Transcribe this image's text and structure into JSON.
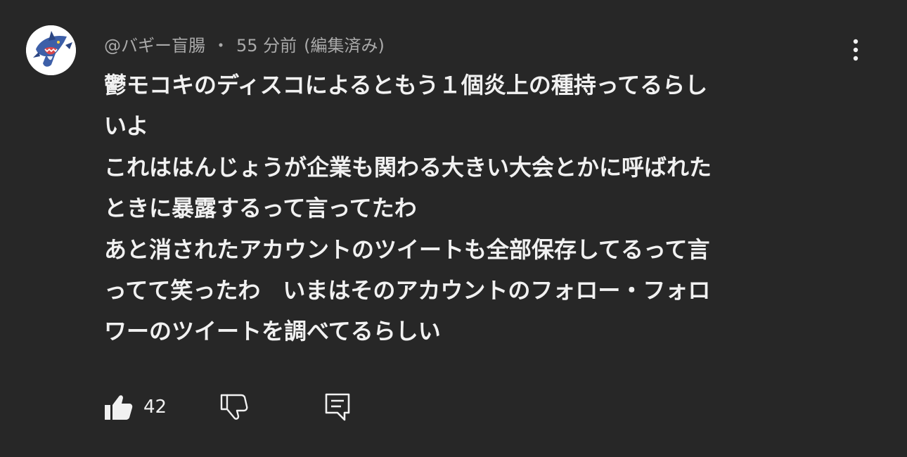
{
  "comment": {
    "author": "@バギー盲腸",
    "separator": "・",
    "time": "55 分前",
    "edited": "(編集済み)",
    "avatar_icon": "shark-avatar",
    "lines": [
      "鬱モコキのディスコによるともう１個炎上の種持ってるらし",
      "いよ",
      "これははんじょうが企業も関わる大きい大会とかに呼ばれた",
      "ときに暴露するって言ってたわ",
      "あと消されたアカウントのツイートも全部保存してるって言",
      "ってて笑ったわ　いまはそのアカウントのフォロー・フォロ",
      "ワーのツイートを調べてるらしい"
    ],
    "actions": {
      "like_icon": "thumbs-up-filled-icon",
      "like_count": "42",
      "dislike_icon": "thumbs-down-outline-icon",
      "reply_icon": "reply-comment-icon"
    },
    "menu_icon": "more-vertical-icon"
  },
  "colors": {
    "background": "#272727",
    "text_primary": "#f1f1f1",
    "text_secondary": "#aaaaaa"
  }
}
